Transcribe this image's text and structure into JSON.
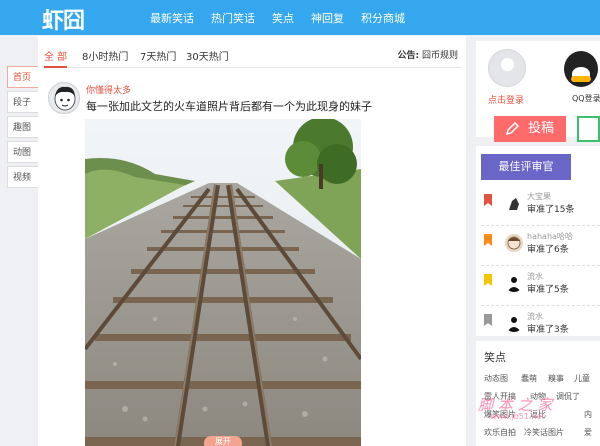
{
  "app": {
    "logo": "虾囧"
  },
  "nav": [
    "最新笑话",
    "热门笑话",
    "笑点",
    "神回复",
    "积分商城"
  ],
  "left_tabs": [
    "首页",
    "段子",
    "趣图",
    "动图",
    "视频"
  ],
  "filter_tabs": [
    "全 部",
    "8小时热门",
    "7天热门",
    "30天热门"
  ],
  "notice": {
    "label": "公告:",
    "text": "囧币规则"
  },
  "post": {
    "username": "你懂得太多",
    "title": "每一张加此文艺的火车道照片背后都有一个为此现身的妹子",
    "bottom_tag": "展开"
  },
  "login": {
    "login_label": "点击登录",
    "qq_label": "QQ登录",
    "submit_label": "投稿"
  },
  "best_reviewers": {
    "title": "最佳评审官",
    "items": [
      {
        "name": "大宝果",
        "count": "审准了15条",
        "flag_color": "#e0533f"
      },
      {
        "name": "hahaha哈哈",
        "count": "审准了6条",
        "flag_color": "#ff8c1a"
      },
      {
        "name": "流水",
        "count": "审准了5条",
        "flag_color": "#f5c400"
      },
      {
        "name": "流水",
        "count": "审准了3条",
        "flag_color": "#999999"
      }
    ]
  },
  "jokes": {
    "title": "笑点",
    "links": [
      "动态图",
      "蠢萌",
      "糗事",
      "儿童",
      "雷人开搞",
      "动物",
      "调侃了",
      "爆笑图片",
      "逗比",
      "内",
      "欢乐自拍",
      "冷笑话图片",
      "爱"
    ]
  },
  "watermark": {
    "text": "脚 本 之 家",
    "url": "www.jb51.net"
  }
}
